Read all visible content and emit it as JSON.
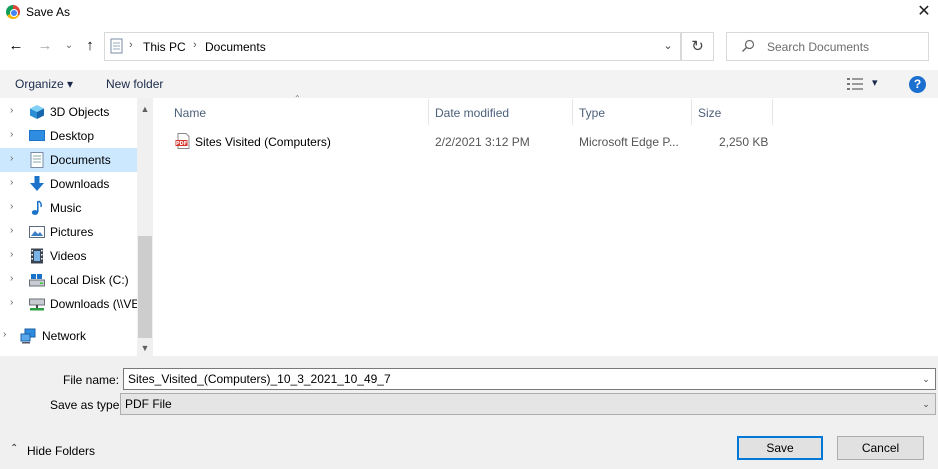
{
  "window": {
    "title": "Save As",
    "close": "✕"
  },
  "nav": {
    "back": "←",
    "forward": "→",
    "recent": "⌄",
    "up": "↑",
    "breadcrumb": [
      "This PC",
      "Documents"
    ],
    "separator": "›",
    "refresh": "↻",
    "dropdown": "⌄",
    "search_placeholder": "Search Documents"
  },
  "toolbar": {
    "organize": "Organize ▾",
    "new_folder": "New folder",
    "view_dd": "▾",
    "help": "?"
  },
  "tree": [
    {
      "label": "3D Objects",
      "icon": "cube-icon"
    },
    {
      "label": "Desktop",
      "icon": "desktop-icon"
    },
    {
      "label": "Documents",
      "icon": "documents-icon",
      "selected": true
    },
    {
      "label": "Downloads",
      "icon": "download-icon"
    },
    {
      "label": "Music",
      "icon": "music-icon"
    },
    {
      "label": "Pictures",
      "icon": "pictures-icon"
    },
    {
      "label": "Videos",
      "icon": "videos-icon"
    },
    {
      "label": "Local Disk (C:)",
      "icon": "local-disk-icon"
    },
    {
      "label": "Downloads (\\\\VE",
      "icon": "network-drive-icon"
    },
    {
      "label": "Network",
      "icon": "network-icon"
    }
  ],
  "tree_chevron": "›",
  "columns": {
    "name": "Name",
    "date": "Date modified",
    "type": "Type",
    "size": "Size",
    "sort": "⌃"
  },
  "files": [
    {
      "name": "Sites Visited (Computers)",
      "date": "2/2/2021 3:12 PM",
      "type": "Microsoft Edge P...",
      "size": "2,250 KB",
      "icon": "pdf-icon",
      "icon_text": "PDF"
    }
  ],
  "form": {
    "file_name_label": "File name:",
    "file_name_value": "Sites_Visited_(Computers)_10_3_2021_10_49_7",
    "type_label": "Save as type:",
    "type_value": "PDF File",
    "dd": "⌄"
  },
  "actions": {
    "hide_folders": "Hide Folders",
    "hide_icon": "⌃",
    "save": "Save",
    "cancel": "Cancel"
  },
  "colors": {
    "selection": "#cce8ff",
    "accent": "#0078d7",
    "toolbar_bg": "#f3f3f3",
    "footer_bg": "#f0f0f0"
  }
}
